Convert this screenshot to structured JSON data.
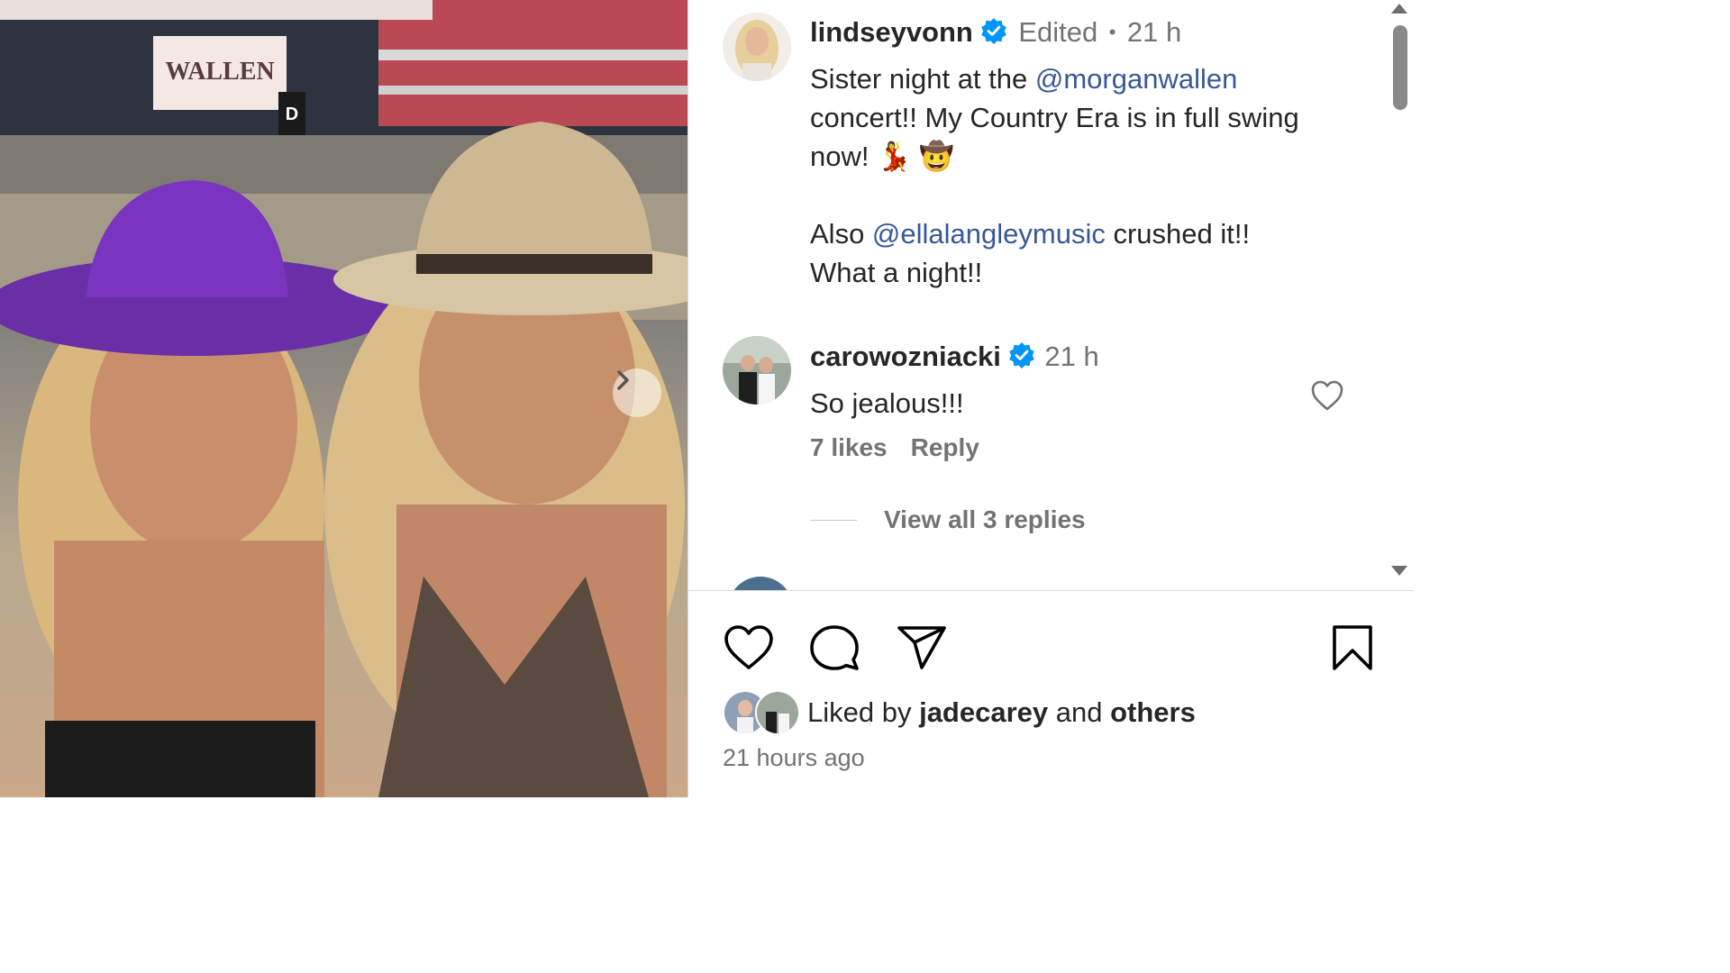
{
  "post": {
    "author": "lindseyvonn",
    "edited_label": "Edited",
    "separator": "•",
    "time": "21 h",
    "caption_line1_prefix": "Sister night at the ",
    "caption_mention1": "@morganwallen",
    "caption_line2": "concert!! My Country Era is in full swing",
    "caption_line3": "now!",
    "caption_emojis": "💃 🤠",
    "caption_line4_prefix": "Also ",
    "caption_mention2": "@ellalangleymusic",
    "caption_line4_suffix": " crushed it!!",
    "caption_line5": "What a night!!",
    "photo_text": {
      "banner": "WALLEN",
      "section_sign": "D"
    }
  },
  "comments": [
    {
      "username": "carowozniacki",
      "time": "21 h",
      "text": "So jealous!!!",
      "likes": "7 likes",
      "reply_label": "Reply",
      "view_replies": "View all 3 replies"
    }
  ],
  "actions": {
    "liked_by_prefix": "Liked by ",
    "liked_by_user": "jadecarey",
    "liked_by_mid": " and ",
    "liked_by_others": "others",
    "time_ago": "21 hours ago"
  },
  "colors": {
    "username": "#262626",
    "meta": "#737373",
    "mention": "#00376b",
    "verified": "#0095f6"
  },
  "icons": [
    "verified-badge-icon",
    "heart-icon",
    "comment-icon",
    "share-icon",
    "bookmark-icon",
    "chevron-right-icon"
  ]
}
